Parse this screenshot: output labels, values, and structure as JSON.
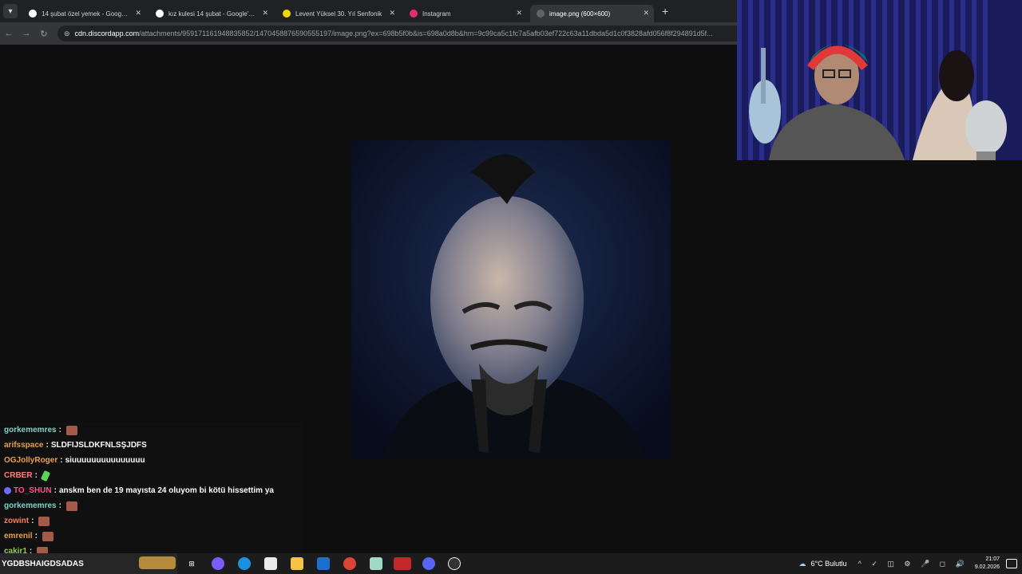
{
  "tabs": [
    {
      "title": "14 şubat özel yemek - Google'd",
      "favicon_color": "#ffffff"
    },
    {
      "title": "kız kulesi 14 şubat - Google'da",
      "favicon_color": "#ffffff"
    },
    {
      "title": "Levent Yüksel 30. Yıl Senfonik",
      "favicon_color": "#f6d400"
    },
    {
      "title": "Instagram",
      "favicon_color": "#e1306c"
    },
    {
      "title": "image.png (600×600)",
      "favicon_color": "#5f6368",
      "active": true
    }
  ],
  "new_tab_label": "+",
  "address": {
    "host": "cdn.discordapp.com",
    "path": "/attachments/959171161948835852/1470458876590555197/image.png?ex=698b5f0b&is=698a0d8b&hm=9c99ca5c1fc7a5afb03ef722c63a11dbda5d1c0f3828afd056f8f294891d5f..."
  },
  "chat": [
    {
      "user": "gorkememres",
      "color": "#7fd1c7",
      "text": "",
      "emote": "brown"
    },
    {
      "user": "arifsspace",
      "color": "#e8a04a",
      "text": "SLDFIJSLDKFNLSŞJDFS"
    },
    {
      "user": "OGJollyRoger",
      "color": "#e8a04a",
      "text": "siuuuuuuuuuuuuuuu"
    },
    {
      "user": "CRBER",
      "color": "#ff7f7f",
      "text": "",
      "emote": "green"
    },
    {
      "user": "TO_SHUN",
      "color": "#ff4f8b",
      "text": "anskm ben de 19 mayısta 24 oluyom bi kötü hissettim ya",
      "badge": true
    },
    {
      "user": "gorkememres",
      "color": "#7fd1c7",
      "text": "",
      "emote": "brown"
    },
    {
      "user": "zowint",
      "color": "#ff7f50",
      "text": "",
      "emote": "brown"
    },
    {
      "user": "emrenil",
      "color": "#e8a04a",
      "text": "",
      "emote": "brown"
    },
    {
      "user": "cakir1",
      "color": "#9acd32",
      "text": "",
      "emote": "brown"
    }
  ],
  "ticker_text": "YGDBSHAIGDSADAS",
  "taskbar": {
    "weather": "6°C  Bulutlu",
    "time": "21:07",
    "date": "9.02.2026"
  },
  "colors": {
    "accent": "#35363a",
    "background": "#0e0e0e"
  }
}
